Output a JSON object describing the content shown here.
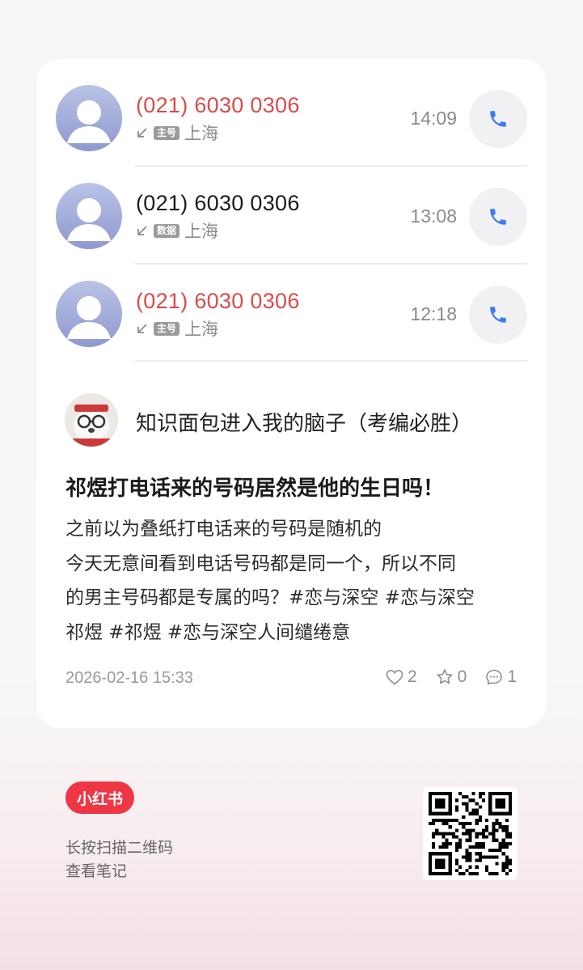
{
  "calls": [
    {
      "number": "(021) 6030 0306",
      "missed": true,
      "sim": "主号",
      "location": "上海",
      "time": "14:09"
    },
    {
      "number": "(021) 6030 0306",
      "missed": false,
      "sim": "数据",
      "location": "上海",
      "time": "13:08"
    },
    {
      "number": "(021) 6030 0306",
      "missed": true,
      "sim": "主号",
      "location": "上海",
      "time": "12:18"
    }
  ],
  "post": {
    "author": "知识面包进入我的脑子（考编必胜）",
    "title": "祁煜打电话来的号码居然是他的生日吗！",
    "body_lines": [
      "之前以为叠纸打电话来的号码是随机的",
      "今天无意间看到电话号码都是同一个，所以不同",
      "的男主号码都是专属的吗？#恋与深空 #恋与深空",
      "祁煜  #祁煜  #恋与深空人间缱绻意"
    ],
    "date": "2026-02-16 15:33",
    "likes": "2",
    "favorites": "0",
    "comments": "1"
  },
  "footer": {
    "brand": "小红书",
    "scan_line1": "长按扫描二维码",
    "scan_line2": "查看笔记"
  },
  "colors": {
    "missed": "#db4b4b",
    "call_icon": "#3b7cf3",
    "brand": "#ee3645"
  },
  "icons": {
    "call": "phone-icon",
    "direction": "incoming-arrow-icon",
    "like": "heart-icon",
    "favorite": "star-icon",
    "comment": "comment-icon"
  }
}
